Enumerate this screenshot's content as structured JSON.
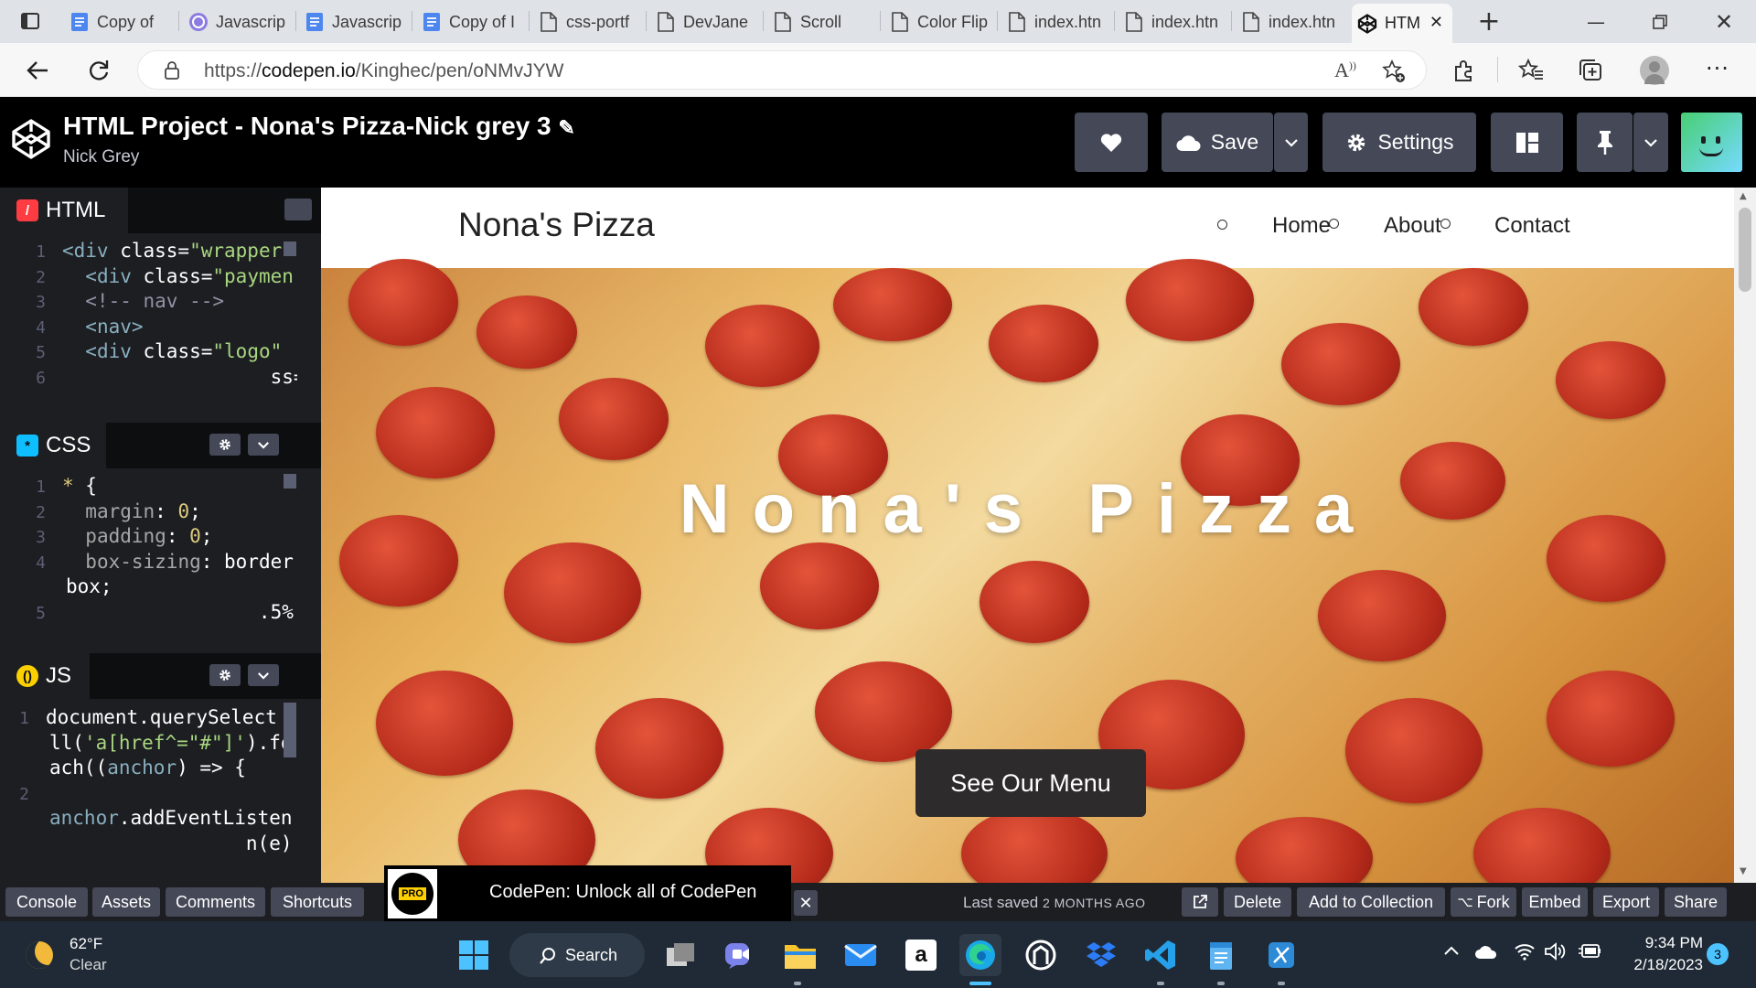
{
  "browser": {
    "tabs": [
      {
        "label": "Copy of",
        "icon": "doc-icon"
      },
      {
        "label": "Javascrip",
        "icon": "profile-icon"
      },
      {
        "label": "Javascrip",
        "icon": "doc-icon"
      },
      {
        "label": "Copy of I",
        "icon": "doc-icon"
      },
      {
        "label": "css-portf",
        "icon": "page-icon"
      },
      {
        "label": "DevJane",
        "icon": "page-icon"
      },
      {
        "label": "Scroll",
        "icon": "page-icon"
      },
      {
        "label": "Color Flip",
        "icon": "page-icon"
      },
      {
        "label": "index.htn",
        "icon": "page-icon"
      },
      {
        "label": "index.htn",
        "icon": "page-icon"
      },
      {
        "label": "index.htn",
        "icon": "page-icon"
      },
      {
        "label": "HTM",
        "icon": "codepen-icon",
        "active": true
      }
    ],
    "url_prefix": "https://",
    "url_host": "codepen.io",
    "url_path": "/Kinghec/pen/oNMvJYW"
  },
  "codepen": {
    "title": "HTML Project - Nona's Pizza-Nick grey 3",
    "author": "Nick Grey",
    "save_label": "Save",
    "settings_label": "Settings"
  },
  "editors": {
    "html": {
      "label": "HTML",
      "lines": [
        {
          "n": "1",
          "code": "<div class=\"wrapper\""
        },
        {
          "n": "2",
          "code": "  <div class=\"paymen"
        },
        {
          "n": "3",
          "code": "  <!-- nav -->"
        },
        {
          "n": "4",
          "code": "  <nav>"
        },
        {
          "n": "5",
          "code": "  <div class=\"logo\""
        },
        {
          "n": "6",
          "code": "                  ss=\"f"
        }
      ]
    },
    "css": {
      "label": "CSS",
      "lines": [
        {
          "n": "1",
          "code": "* {"
        },
        {
          "n": "2",
          "code": "  margin: 0;"
        },
        {
          "n": "3",
          "code": "  padding: 0;"
        },
        {
          "n": "4",
          "code": "  box-sizing: border"
        },
        {
          "n": "",
          "code": "box;"
        },
        {
          "n": "5",
          "code": "                 .5%;"
        }
      ]
    },
    "js": {
      "label": "JS",
      "lines": [
        {
          "n": "1",
          "code": "document.querySelect"
        },
        {
          "n": "",
          "code": "ll('a[href^=\"#\"]').fo"
        },
        {
          "n": "",
          "code": "ach((anchor) => {"
        },
        {
          "n": "2",
          "code": ""
        },
        {
          "n": "",
          "code": "anchor.addEventListen"
        },
        {
          "n": "",
          "code": "                 n(e)"
        }
      ]
    }
  },
  "preview": {
    "logo": "Nona's Pizza",
    "nav": [
      "Home",
      "About",
      "Contact"
    ],
    "hero_title": "Nona's Pizza",
    "cta": "See Our Menu"
  },
  "footer": {
    "left_buttons": [
      "Console",
      "Assets",
      "Comments",
      "Shortcuts"
    ],
    "promo_badge": "PRO",
    "promo_text": "CodePen: Unlock all of CodePen",
    "last_saved": "Last saved",
    "last_saved_when": "2 MONTHS AGO",
    "right_buttons": [
      "Delete",
      "Add to Collection",
      "Fork",
      "Embed",
      "Export",
      "Share"
    ]
  },
  "taskbar": {
    "weather_temp": "62°F",
    "weather_desc": "Clear",
    "search_label": "Search",
    "time": "9:34 PM",
    "date": "2/18/2023",
    "notif_count": "3"
  },
  "colors": {
    "codepen_btn": "#444857",
    "html_badge": "#ff3c41",
    "css_badge": "#0ebeff",
    "js_badge": "#fcd000"
  }
}
